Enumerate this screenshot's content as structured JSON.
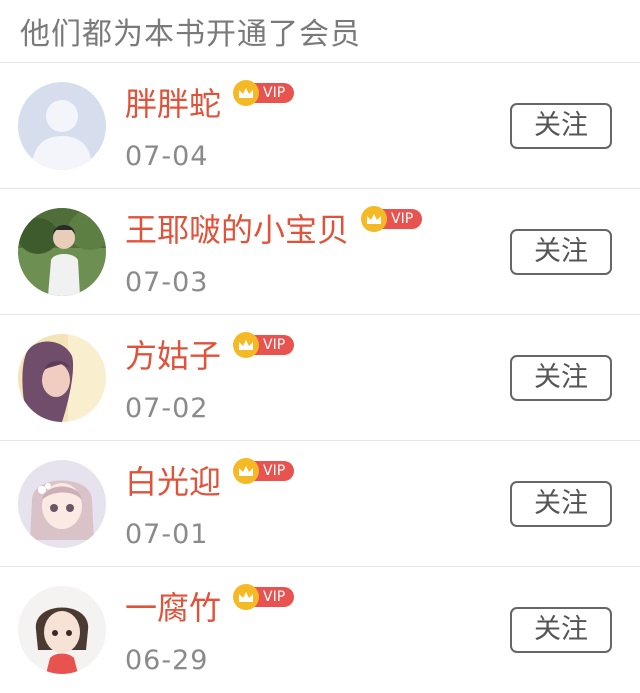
{
  "header": {
    "title": "他们都为本书开通了会员"
  },
  "vip_label": "VIP",
  "follow_label": "关注",
  "members": [
    {
      "name": "胖胖蛇",
      "date": "07-04",
      "avatar": "default-avatar"
    },
    {
      "name": "王耶啵的小宝贝",
      "date": "07-03",
      "avatar": "photo-avatar"
    },
    {
      "name": "方姑子",
      "date": "07-02",
      "avatar": "photo-avatar"
    },
    {
      "name": "白光迎",
      "date": "07-01",
      "avatar": "illustration-avatar"
    },
    {
      "name": "一腐竹",
      "date": "06-29",
      "avatar": "illustration-avatar"
    }
  ],
  "colors": {
    "name": "#e0533a",
    "vip_badge": "#e8534f",
    "crown": "#f6b926",
    "divider": "#e6e6e6"
  }
}
